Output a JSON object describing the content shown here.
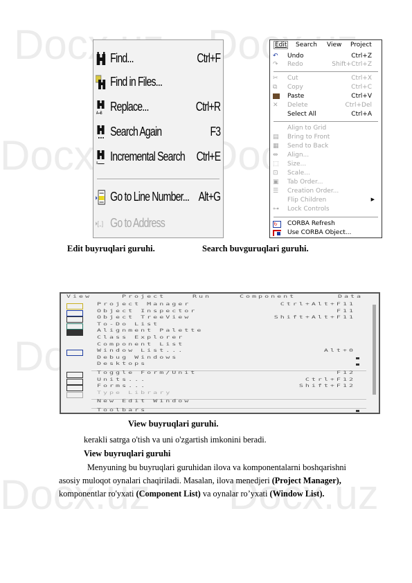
{
  "watermark": "Docx.uz",
  "search_menu": {
    "items": [
      {
        "icon": "binoculars-icon",
        "label": "Find...",
        "shortcut": "Ctrl+F",
        "disabled": false
      },
      {
        "icon": "find-in-files-icon",
        "label": "Find in Files...",
        "shortcut": "",
        "disabled": false
      },
      {
        "icon": "replace-icon",
        "label": "Replace...",
        "shortcut": "Ctrl+R",
        "disabled": false
      },
      {
        "icon": "search-again-icon",
        "label": "Search Again",
        "shortcut": "F3",
        "disabled": false
      },
      {
        "icon": "incremental-search-icon",
        "label": "Incremental Search",
        "shortcut": "Ctrl+E",
        "disabled": false
      },
      {
        "icon": "goto-line-icon",
        "label": "Go to Line Number...",
        "shortcut": "Alt+G",
        "disabled": false
      },
      {
        "icon": "goto-address-icon",
        "label": "Go to Address",
        "shortcut": "",
        "disabled": true
      }
    ]
  },
  "edit_menu": {
    "menubar": [
      "Edit",
      "Search",
      "View",
      "Project"
    ],
    "items": [
      {
        "icon": "undo-icon",
        "label": "Undo",
        "shortcut": "Ctrl+Z",
        "disabled": false
      },
      {
        "icon": "redo-icon",
        "label": "Redo",
        "shortcut": "Shift+Ctrl+Z",
        "disabled": true
      },
      {
        "icon": "cut-icon",
        "label": "Cut",
        "shortcut": "Ctrl+X",
        "disabled": true
      },
      {
        "icon": "copy-icon",
        "label": "Copy",
        "shortcut": "Ctrl+C",
        "disabled": true
      },
      {
        "icon": "paste-icon",
        "label": "Paste",
        "shortcut": "Ctrl+V",
        "disabled": false
      },
      {
        "icon": "delete-icon",
        "label": "Delete",
        "shortcut": "Ctrl+Del",
        "disabled": true
      },
      {
        "icon": "",
        "label": "Select All",
        "shortcut": "Ctrl+A",
        "disabled": false
      },
      {
        "icon": "",
        "label": "Align to Grid",
        "shortcut": "",
        "disabled": true
      },
      {
        "icon": "bring-to-front-icon",
        "label": "Bring to Front",
        "shortcut": "",
        "disabled": true
      },
      {
        "icon": "send-to-back-icon",
        "label": "Send to Back",
        "shortcut": "",
        "disabled": true
      },
      {
        "icon": "align-icon",
        "label": "Align...",
        "shortcut": "",
        "disabled": true
      },
      {
        "icon": "size-icon",
        "label": "Size...",
        "shortcut": "",
        "disabled": true
      },
      {
        "icon": "scale-icon",
        "label": "Scale...",
        "shortcut": "",
        "disabled": true
      },
      {
        "icon": "tab-order-icon",
        "label": "Tab Order...",
        "shortcut": "",
        "disabled": true
      },
      {
        "icon": "creation-order-icon",
        "label": "Creation Order...",
        "shortcut": "",
        "disabled": true
      },
      {
        "icon": "",
        "label": "Flip Children",
        "shortcut": "",
        "disabled": true,
        "submenu": true
      },
      {
        "icon": "lock-controls-icon",
        "label": "Lock Controls",
        "shortcut": "",
        "disabled": true
      },
      {
        "icon": "corba-refresh-icon",
        "label": "CORBA Refresh",
        "shortcut": "",
        "disabled": false
      },
      {
        "icon": "use-corba-object-icon",
        "label": "Use CORBA Object...",
        "shortcut": "",
        "disabled": false
      }
    ]
  },
  "captions": {
    "edit": "Edit buyruqlari guruhi.",
    "search": "Search buvguruqlari guruhi.",
    "view": "View buyruqlari guruhi."
  },
  "view_menu": {
    "menubar": [
      "View",
      "Project",
      "Run",
      "Component",
      "Data"
    ],
    "items": [
      {
        "icon": "project-manager-icon",
        "label": "Project Manager",
        "shortcut": "Ctrl+Alt+F11"
      },
      {
        "icon": "object-inspector-icon",
        "label": "Object Inspector",
        "shortcut": "F11"
      },
      {
        "icon": "object-treeview-icon",
        "label": "Object TreeView",
        "shortcut": "Shift+Alt+F11"
      },
      {
        "icon": "to-do-list-icon",
        "label": "To-Do List",
        "shortcut": ""
      },
      {
        "icon": "alignment-palette-icon",
        "label": "Alignment Palette",
        "shortcut": ""
      },
      {
        "icon": "",
        "label": "Class Explorer",
        "shortcut": ""
      },
      {
        "icon": "",
        "label": "Component List",
        "shortcut": ""
      },
      {
        "icon": "window-list-icon",
        "label": "Window List...",
        "shortcut": "Alt+0"
      },
      {
        "icon": "",
        "label": "Debug Windows",
        "shortcut": "",
        "submenu": true
      },
      {
        "icon": "",
        "label": "Desktops",
        "shortcut": "",
        "submenu": true
      },
      {
        "icon": "toggle-form-unit-icon",
        "label": "Toggle Form/Unit",
        "shortcut": "F12"
      },
      {
        "icon": "units-icon",
        "label": "Units...",
        "shortcut": "Ctrl+F12"
      },
      {
        "icon": "forms-icon",
        "label": "Forms...",
        "shortcut": "Shift+F12"
      },
      {
        "icon": "type-library-icon",
        "label": "Type Library",
        "shortcut": "",
        "disabled": true
      },
      {
        "icon": "",
        "label": "New Edit Window",
        "shortcut": ""
      },
      {
        "icon": "",
        "label": "Toolbars",
        "shortcut": "",
        "submenu": true
      }
    ]
  },
  "body": {
    "line1": "kerakli satrga o'tish va uni o'zgartish imkonini beradi.",
    "heading": "View buyruqlari guruhi",
    "p1_line1": "Menyuning bu buyruqlari guruhidan ilova va komponentalarni boshqarishni",
    "p1_line2_a": "asosiy muloqot oynalari chaqiriladi. Masalan, ilova menedjeri ",
    "p1_line2_b": "(Project Manager),",
    "p1_line3_a": "komponentlar ro'yxati ",
    "p1_line3_b": "(Component List)",
    "p1_line3_c": " va oynalar ro’yxati ",
    "p1_line3_d": "(Window List)."
  }
}
